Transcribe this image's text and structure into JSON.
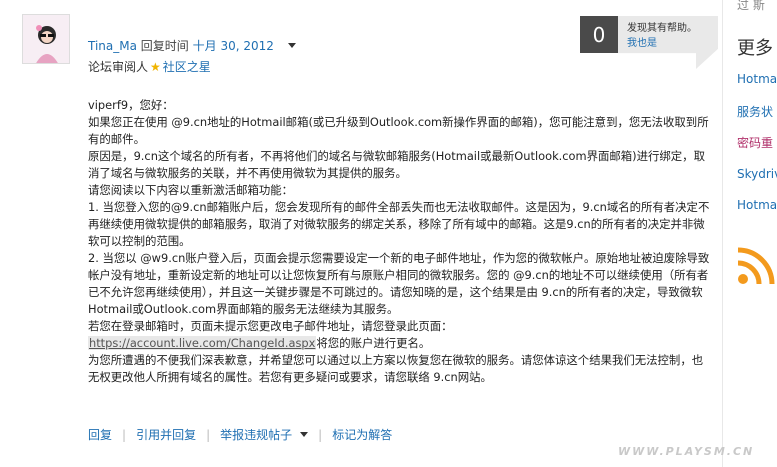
{
  "post": {
    "author": "Tina_Ma",
    "reply_time_label": "回复时间",
    "reply_date": "十月 30, 2012",
    "role": "论坛审阅人",
    "star_icon": "★",
    "star_label": "社区之星"
  },
  "helpful": {
    "count": "0",
    "question": "发现其有帮助。",
    "link": "我也是"
  },
  "body": {
    "greeting": "viperf9，您好：",
    "lines": [
      "如果您正在使用 @9.cn地址的Hotmail邮箱(或已升级到Outlook.com新操作界面的邮箱)，您可能注意到，您无法收取到所有的邮件。",
      "原因是，9.cn这个域名的所有者，不再将他们的域名与微软邮箱服务(Hotmail或最新Outlook.com界面邮箱)进行绑定，取消了域名与微软服务的关联，并不再使用微软为其提供的服务。",
      "请您阅读以下内容以重新激活邮箱功能：",
      "1. 当您登入您的@9.cn邮箱账户后，您会发现所有的邮件全部丢失而也无法收取邮件。这是因为，9.cn域名的所有者决定不再继续使用微软提供的邮箱服务，取消了对微软服务的绑定关系，移除了所有域中的邮箱。这是9.cn的所有者的决定并非微软可以控制的范围。",
      "2. 当您以 @w9.cn账户登入后，页面会提示您需要设定一个新的电子邮件地址，作为您的微软帐户。原始地址被迫废除导致帐户没有地址，重新设定新的地址可以让您恢复所有与原账户相同的微软服务。您的 @9.cn的地址不可以继续使用（所有者已不允许您再继续使用），并且这一关键步骤是不可跳过的。请您知晓的是，这个结果是由 9.cn的所有者的决定，导致微软Hotmail或Outlook.com界面邮箱的服务无法继续为其服务。",
      "若您在登录邮箱时，页面未提示您更改电子邮件地址，请您登录此页面："
    ],
    "url": "https://account.live.com/ChangeId.aspx",
    "url_suffix": "将您的账户进行更名。",
    "closing": "为您所遭遇的不便我们深表歉意，并希望您可以通过以上方案以恢复您在微软的服务。请您体谅这个结果我们无法控制，也无权更改他人所拥有域名的属性。若您有更多疑问或要求，请您联络 9.cn网站。"
  },
  "actions": {
    "reply": "回复",
    "quote": "引用并回复",
    "report": "举报违规帖子",
    "mark_answer": "标记为解答"
  },
  "sidebar": {
    "top_fragment": "过 斯",
    "heading": "更多",
    "items": [
      {
        "label": "Hotmai",
        "color": "#1f6fb2"
      },
      {
        "label": "服务状",
        "color": "#1f6fb2"
      },
      {
        "label": "密码重",
        "color": "#b0306a"
      },
      {
        "label": "Skydriv",
        "color": "#1f6fb2"
      },
      {
        "label": "Hotmai",
        "color": "#1f6fb2"
      }
    ],
    "rss_icon": "rss-icon"
  },
  "watermark": "WWW.PLAYSM.CN",
  "colors": {
    "link": "#1f6fb2",
    "help_dark": "#4a4a4a",
    "help_panel": "#e9e9e9",
    "rss": "#f39a1d",
    "star": "#f0b400"
  }
}
